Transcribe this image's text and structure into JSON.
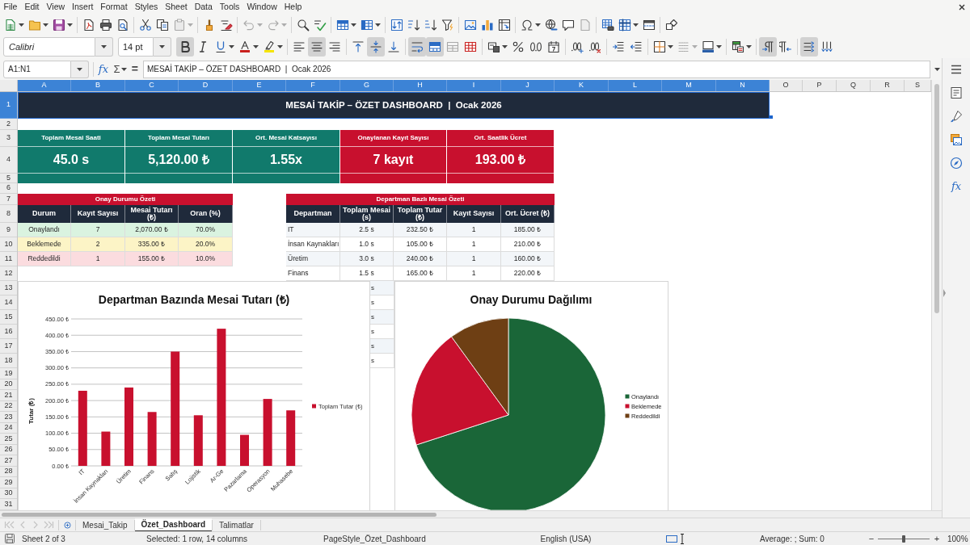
{
  "menu_bar": {
    "items": [
      "File",
      "Edit",
      "View",
      "Insert",
      "Format",
      "Styles",
      "Sheet",
      "Data",
      "Tools",
      "Window",
      "Help"
    ]
  },
  "standard_toolbar": {
    "groups": [
      [
        {
          "kind": "new",
          "dropdown": true,
          "disabled": false
        },
        {
          "kind": "open",
          "dropdown": true,
          "disabled": false
        },
        {
          "kind": "save",
          "dropdown": true,
          "disabled": false
        }
      ],
      [
        {
          "kind": "export-pdf",
          "dropdown": false,
          "disabled": false
        },
        {
          "kind": "print",
          "dropdown": false,
          "disabled": false
        },
        {
          "kind": "print-preview",
          "dropdown": false,
          "disabled": false
        }
      ],
      [
        {
          "kind": "cut",
          "dropdown": false,
          "disabled": false
        },
        {
          "kind": "copy",
          "dropdown": false,
          "disabled": false
        },
        {
          "kind": "paste",
          "dropdown": true,
          "disabled": true
        }
      ],
      [
        {
          "kind": "clone-formatting",
          "dropdown": false,
          "disabled": false
        },
        {
          "kind": "clear-formatting",
          "dropdown": false,
          "disabled": false
        }
      ],
      [
        {
          "kind": "undo",
          "dropdown": true,
          "disabled": true
        },
        {
          "kind": "redo",
          "dropdown": true,
          "disabled": true
        }
      ],
      [
        {
          "kind": "find-replace",
          "dropdown": false,
          "disabled": false
        },
        {
          "kind": "spelling",
          "dropdown": false,
          "disabled": false
        }
      ],
      [
        {
          "kind": "rows",
          "dropdown": true,
          "disabled": false
        },
        {
          "kind": "columns",
          "dropdown": true,
          "disabled": false
        }
      ],
      [
        {
          "kind": "sort",
          "dropdown": false,
          "disabled": false
        },
        {
          "kind": "sort-ascending",
          "dropdown": false,
          "disabled": false
        },
        {
          "kind": "sort-descending",
          "dropdown": false,
          "disabled": false
        },
        {
          "kind": "autofilter",
          "dropdown": false,
          "disabled": false
        }
      ],
      [
        {
          "kind": "image",
          "dropdown": false,
          "disabled": false
        },
        {
          "kind": "chart",
          "dropdown": false,
          "disabled": false
        },
        {
          "kind": "pivot-table",
          "dropdown": false,
          "disabled": false
        }
      ],
      [
        {
          "kind": "special-character",
          "dropdown": true,
          "disabled": false
        },
        {
          "kind": "hyperlink",
          "dropdown": false,
          "disabled": false
        },
        {
          "kind": "comment",
          "dropdown": false,
          "disabled": false
        },
        {
          "kind": "headers-footers",
          "dropdown": false,
          "disabled": true
        }
      ],
      [
        {
          "kind": "print-area",
          "dropdown": false,
          "disabled": false
        },
        {
          "kind": "freeze",
          "dropdown": true,
          "disabled": false
        },
        {
          "kind": "split-window",
          "dropdown": false,
          "disabled": false
        }
      ],
      [
        {
          "kind": "draw-functions",
          "dropdown": false,
          "disabled": false
        }
      ]
    ]
  },
  "formatting_toolbar": {
    "font_name": "Calibri",
    "font_size": "14 pt",
    "groups": [
      [
        {
          "kind": "bold",
          "dropdown": false,
          "on": true,
          "disabled": false
        },
        {
          "kind": "italic",
          "dropdown": false,
          "on": false,
          "disabled": false
        },
        {
          "kind": "underline",
          "dropdown": true,
          "on": false,
          "disabled": false
        },
        {
          "kind": "font-color",
          "dropdown": true,
          "on": false,
          "disabled": false
        },
        {
          "kind": "highlight",
          "dropdown": true,
          "on": false,
          "disabled": false
        }
      ],
      [
        {
          "kind": "align-left",
          "dropdown": false,
          "on": false,
          "disabled": false
        },
        {
          "kind": "align-center",
          "dropdown": false,
          "on": true,
          "disabled": false
        },
        {
          "kind": "align-right",
          "dropdown": false,
          "on": false,
          "disabled": false
        }
      ],
      [
        {
          "kind": "align-top",
          "dropdown": false,
          "on": false,
          "disabled": false
        },
        {
          "kind": "align-middle",
          "dropdown": false,
          "on": true,
          "disabled": false
        },
        {
          "kind": "align-bottom",
          "dropdown": false,
          "on": false,
          "disabled": false
        }
      ],
      [
        {
          "kind": "wrap-text",
          "dropdown": false,
          "on": true,
          "disabled": false
        },
        {
          "kind": "merge-center",
          "dropdown": false,
          "on": true,
          "disabled": false
        },
        {
          "kind": "merge-cells",
          "dropdown": false,
          "on": false,
          "disabled": true
        },
        {
          "kind": "unmerge-cells",
          "dropdown": false,
          "on": false,
          "disabled": false
        }
      ],
      [
        {
          "kind": "currency-format",
          "dropdown": true,
          "on": false,
          "disabled": false
        },
        {
          "kind": "percent-format",
          "dropdown": false,
          "on": false,
          "disabled": false
        },
        {
          "kind": "number-format",
          "dropdown": false,
          "on": false,
          "disabled": false
        },
        {
          "kind": "date-format",
          "dropdown": false,
          "on": false,
          "disabled": false
        }
      ],
      [
        {
          "kind": "add-decimal",
          "dropdown": false,
          "on": false,
          "disabled": false
        },
        {
          "kind": "delete-decimal",
          "dropdown": false,
          "on": false,
          "disabled": false
        }
      ],
      [
        {
          "kind": "increase-indent",
          "dropdown": false,
          "on": false,
          "disabled": false
        },
        {
          "kind": "decrease-indent",
          "dropdown": false,
          "on": false,
          "disabled": false
        }
      ],
      [
        {
          "kind": "borders",
          "dropdown": true,
          "on": false,
          "disabled": false
        },
        {
          "kind": "border-style",
          "dropdown": true,
          "on": false,
          "disabled": true
        },
        {
          "kind": "border-color",
          "dropdown": true,
          "on": false,
          "disabled": false
        }
      ],
      [
        {
          "kind": "conditional-format",
          "dropdown": true,
          "on": false,
          "disabled": false
        }
      ],
      [
        {
          "kind": "left-to-right",
          "dropdown": false,
          "on": true,
          "disabled": false
        },
        {
          "kind": "right-to-left",
          "dropdown": false,
          "on": false,
          "disabled": false
        }
      ],
      [
        {
          "kind": "text-left-to-right",
          "dropdown": false,
          "on": true,
          "disabled": false
        },
        {
          "kind": "text-top-to-bottom",
          "dropdown": false,
          "on": false,
          "disabled": false
        }
      ]
    ]
  },
  "formula_bar": {
    "name_box": "A1:N1",
    "function_wizard": "fx",
    "sum": "Σ",
    "equals": "=",
    "content": "MESAİ TAKİP – ÖZET DASHBOARD  |  Ocak 2026"
  },
  "column_headers": [
    {
      "label": "A",
      "selected": true
    },
    {
      "label": "B",
      "selected": true
    },
    {
      "label": "C",
      "selected": true
    },
    {
      "label": "D",
      "selected": true
    },
    {
      "label": "E",
      "selected": true
    },
    {
      "label": "F",
      "selected": true
    },
    {
      "label": "G",
      "selected": true
    },
    {
      "label": "H",
      "selected": true
    },
    {
      "label": "I",
      "selected": true
    },
    {
      "label": "J",
      "selected": true
    },
    {
      "label": "K",
      "selected": true
    },
    {
      "label": "L",
      "selected": true
    },
    {
      "label": "M",
      "selected": true
    },
    {
      "label": "N",
      "selected": true
    },
    {
      "label": "O",
      "selected": false
    },
    {
      "label": "P",
      "selected": false
    },
    {
      "label": "Q",
      "selected": false
    },
    {
      "label": "R",
      "selected": false
    },
    {
      "label": "S",
      "selected": false
    }
  ],
  "row_headers": [
    {
      "label": "1",
      "selected": true
    },
    {
      "label": "2",
      "selected": false
    },
    {
      "label": "3",
      "selected": false
    },
    {
      "label": "4",
      "selected": false
    },
    {
      "label": "5",
      "selected": false
    },
    {
      "label": "6",
      "selected": false
    },
    {
      "label": "7",
      "selected": false
    },
    {
      "label": "8",
      "selected": false
    },
    {
      "label": "9",
      "selected": false
    },
    {
      "label": "10",
      "selected": false
    },
    {
      "label": "11",
      "selected": false
    },
    {
      "label": "12",
      "selected": false
    },
    {
      "label": "13",
      "selected": false
    },
    {
      "label": "14",
      "selected": false
    },
    {
      "label": "15",
      "selected": false
    },
    {
      "label": "16",
      "selected": false
    },
    {
      "label": "17",
      "selected": false
    },
    {
      "label": "18",
      "selected": false
    },
    {
      "label": "19",
      "selected": false
    },
    {
      "label": "20",
      "selected": false
    },
    {
      "label": "21",
      "selected": false
    },
    {
      "label": "22",
      "selected": false
    },
    {
      "label": "23",
      "selected": false
    },
    {
      "label": "24",
      "selected": false
    },
    {
      "label": "25",
      "selected": false
    },
    {
      "label": "26",
      "selected": false
    },
    {
      "label": "27",
      "selected": false
    },
    {
      "label": "28",
      "selected": false
    },
    {
      "label": "29",
      "selected": false
    },
    {
      "label": "30",
      "selected": false
    },
    {
      "label": "31",
      "selected": false
    }
  ],
  "title_banner": {
    "text": "MESAİ TAKİP – ÖZET DASHBOARD  |  Ocak 2026",
    "selected": true
  },
  "kpi_cards": [
    {
      "label": "Toplam Mesai Saati",
      "value": "45.0 s",
      "color": "#117a6c"
    },
    {
      "label": "Toplam Mesai Tutarı",
      "value": "5,120.00 ₺",
      "color": "#117a6c"
    },
    {
      "label": "Ort. Mesai Katsayısı",
      "value": "1.55x",
      "color": "#117a6c"
    },
    {
      "label": "Onaylanan Kayıt Sayısı",
      "value": "7 kayıt",
      "color": "#c8102e"
    },
    {
      "label": "Ort. Saatlik Ücret",
      "value": "193.00 ₺",
      "color": "#c8102e"
    }
  ],
  "status_summary": {
    "title": "Onay Durumu Özeti",
    "columns": [
      "Durum",
      "Kayıt Sayısı",
      "Mesai Tutarı (₺)",
      "Oran (%)"
    ],
    "rows": [
      {
        "cells": [
          "Onaylandı",
          "7",
          "2,070.00 ₺",
          "70.0%"
        ],
        "color": "#daf3e0"
      },
      {
        "cells": [
          "Beklemede",
          "2",
          "335.00 ₺",
          "20.0%"
        ],
        "color": "#fcf4c6"
      },
      {
        "cells": [
          "Reddedildi",
          "1",
          "155.00 ₺",
          "10.0%"
        ],
        "color": "#fbdcdf"
      }
    ]
  },
  "department_summary": {
    "title": "Departman Bazlı Mesai Özeti",
    "columns": [
      "Departman",
      "Toplam Mesai (s)",
      "Toplam Tutar (₺)",
      "Kayıt Sayısı",
      "Ort. Ücret (₺)"
    ],
    "rows": [
      [
        "IT",
        "2.5 s",
        "232.50 ₺",
        "1",
        "185.00 ₺"
      ],
      [
        "İnsan Kaynakları",
        "1.0 s",
        "105.00 ₺",
        "1",
        "210.00 ₺"
      ],
      [
        "Üretim",
        "3.0 s",
        "240.00 ₺",
        "1",
        "160.00 ₺"
      ],
      [
        "Finans",
        "1.5 s",
        "165.00 ₺",
        "1",
        "220.00 ₺"
      ]
    ],
    "covered_rows": [
      "s",
      "s",
      "s",
      "s",
      "s",
      "s"
    ]
  },
  "bar_chart": {
    "chart_data": {
      "type": "bar",
      "title": "Departman Bazında Mesai Tutarı (₺)",
      "ylabel": "Tutar (₺)",
      "categories": [
        "IT",
        "İnsan Kaynakları",
        "Üretim",
        "Finans",
        "Satış",
        "Lojistik",
        "Ar-Ge",
        "Pazarlama",
        "Operasyon",
        "Muhasebe"
      ],
      "series": [
        {
          "name": "Toplam Tutar (₺)",
          "color": "#c8102e",
          "values": [
            230,
            105,
            240,
            165,
            350,
            155,
            420,
            95,
            205,
            170
          ]
        }
      ],
      "ylim": [
        0,
        450
      ],
      "yticks": [
        {
          "value": 0,
          "label": "0.00 ₺"
        },
        {
          "value": 50,
          "label": "50.00 ₺"
        },
        {
          "value": 100,
          "label": "100.00 ₺"
        },
        {
          "value": 150,
          "label": "150.00 ₺"
        },
        {
          "value": 200,
          "label": "200.00 ₺"
        },
        {
          "value": 250,
          "label": "250.00 ₺"
        },
        {
          "value": 300,
          "label": "300.00 ₺"
        },
        {
          "value": 350,
          "label": "350.00 ₺"
        },
        {
          "value": 400,
          "label": "400.00 ₺"
        },
        {
          "value": 450,
          "label": "450.00 ₺"
        }
      ],
      "grid": true,
      "legend": true
    }
  },
  "pie_chart": {
    "chart_data": {
      "type": "pie",
      "title": "Onay Durumu Dağılımı",
      "categories": [
        "Onaylandı",
        "Beklemede",
        "Reddedildi"
      ],
      "values": [
        70,
        20,
        10
      ],
      "colors": [
        "#1a6638",
        "#c8102e",
        "#6e3f14"
      ],
      "legend": true
    }
  },
  "sidebar": {
    "functions_label": "fx"
  },
  "sheet_tab_bar": {
    "navigation_disabled": true,
    "tabs": [
      {
        "label": "Mesai_Takip",
        "selected": false
      },
      {
        "label": "Özet_Dashboard",
        "selected": true
      },
      {
        "label": "Talimatlar",
        "selected": false
      }
    ]
  },
  "status_bar": {
    "sheet_position": "Sheet 2 of 3",
    "selection_info": "Selected: 1 row, 14 columns",
    "page_style": "PageStyle_Özet_Dashboard",
    "language": "English (USA)",
    "selection_summary": "Average: ; Sum: 0",
    "zoom_out": "−",
    "zoom_slider": {
      "level": 0.5
    },
    "zoom_in": "+",
    "zoom": "100%"
  }
}
